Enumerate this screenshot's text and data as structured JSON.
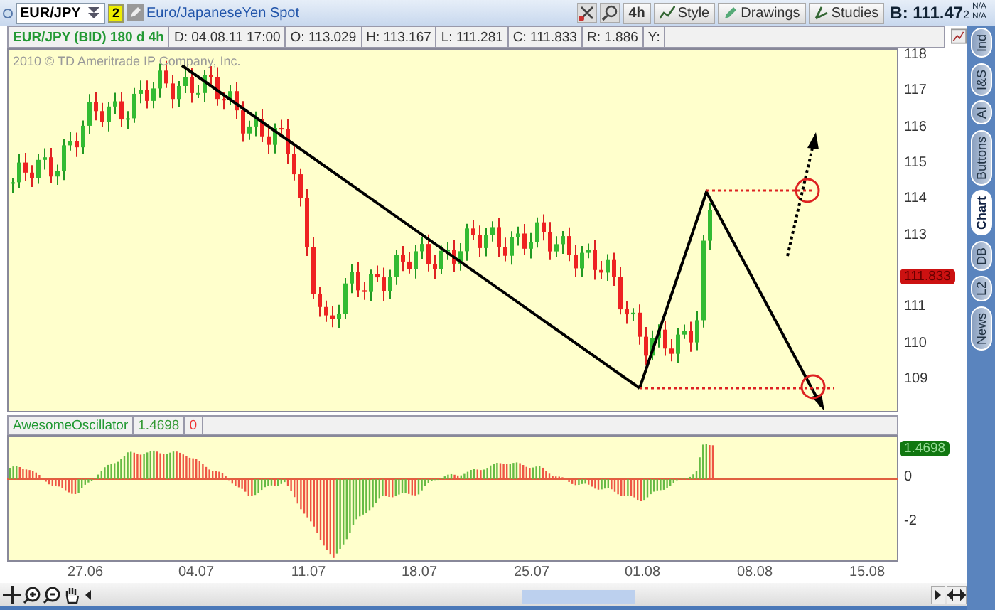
{
  "toolbar": {
    "symbol": "EUR/JPY",
    "badge": "2",
    "description": "Euro/JapaneseYen Spot",
    "buttons": [
      {
        "label": "4h",
        "kind": "plain"
      },
      {
        "label": "Style",
        "kind": "style"
      },
      {
        "label": "Drawings",
        "kind": "drawings"
      },
      {
        "label": "Studies",
        "kind": "studies"
      }
    ],
    "bid": "B: 111.47",
    "bid_suffix": "2",
    "na": [
      "N/A",
      "N/A"
    ]
  },
  "info": [
    "EUR/JPY (BID) 180 d 4h",
    "D: 04.08.11 17:00",
    "O: 113.029",
    "H: 113.167",
    "L: 111.281",
    "C: 111.833",
    "R: 1.886",
    "Y:"
  ],
  "copyright": "2010 © TD Ameritrade IP Company, Inc.",
  "price_axis": [
    "118",
    "117",
    "116",
    "115",
    "114",
    "113",
    "111",
    "110",
    "109"
  ],
  "last_price": "111.833",
  "side_tabs": [
    {
      "label": "Ind",
      "selected": false
    },
    {
      "label": "I&S",
      "selected": false
    },
    {
      "label": "AI",
      "selected": false
    },
    {
      "label": "Buttons",
      "selected": false
    },
    {
      "label": "Chart",
      "selected": true
    },
    {
      "label": "DB",
      "selected": false
    },
    {
      "label": "L2",
      "selected": false
    },
    {
      "label": "News",
      "selected": false
    }
  ],
  "oscillator": {
    "name": "AwesomeOscillator",
    "value": "1.4698",
    "zero_value": "0",
    "value_badge": "1.4698",
    "axis": [
      "0",
      "-2"
    ]
  },
  "dates": [
    "27.06",
    "04.07",
    "11.07",
    "18.07",
    "25.07",
    "01.08",
    "08.08",
    "15.08"
  ]
}
